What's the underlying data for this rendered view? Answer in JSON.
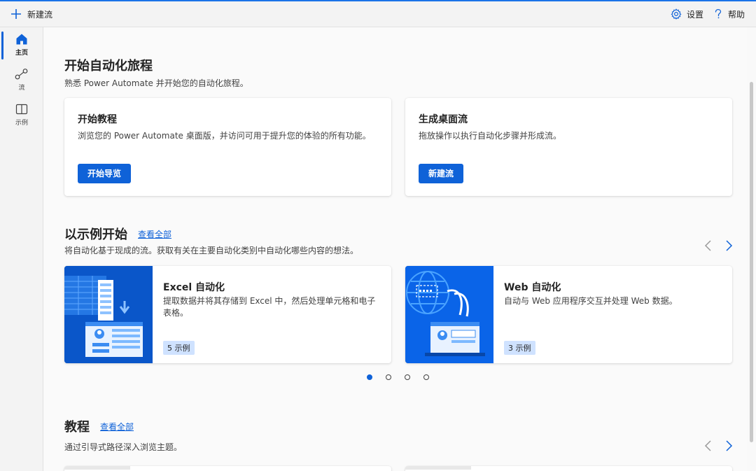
{
  "topbar": {
    "new_flow_label": "新建流",
    "settings_label": "设置",
    "help_label": "帮助"
  },
  "sidebar": {
    "items": [
      {
        "label": "主页",
        "icon": "home-icon",
        "active": true
      },
      {
        "label": "流",
        "icon": "flow-icon",
        "active": false
      },
      {
        "label": "示例",
        "icon": "examples-icon",
        "active": false
      }
    ]
  },
  "hero": {
    "title": "开始自动化旅程",
    "subtitle": "熟悉 Power Automate 并开始您的自动化旅程。",
    "cards": [
      {
        "title": "开始教程",
        "description": "浏览您的 Power Automate 桌面版，并访问可用于提升您的体验的所有功能。",
        "button": "开始导览"
      },
      {
        "title": "生成桌面流",
        "description": "拖放操作以执行自动化步骤并形成流。",
        "button": "新建流"
      }
    ]
  },
  "examples": {
    "title": "以示例开始",
    "see_all": "查看全部",
    "subtitle": "将自动化基于现成的流。获取有关在主要自动化类别中自动化哪些内容的想法。",
    "cards": [
      {
        "title": "Excel 自动化",
        "description": "提取数据并将其存储到 Excel 中，然后处理单元格和电子表格。",
        "badge": "5 示例"
      },
      {
        "title": "Web 自动化",
        "description": "自动与 Web 应用程序交互并处理 Web 数据。",
        "badge": "3 示例"
      }
    ],
    "pager": {
      "count": 4,
      "active_index": 0
    }
  },
  "tutorials": {
    "title": "教程",
    "see_all": "查看全部",
    "subtitle": "通过引导式路径深入浏览主题。"
  },
  "colors": {
    "accent": "#0f62d8",
    "sidebar_bg": "#f3f3f3",
    "content_bg": "#fafafa",
    "illustration_bg": "#0a56c9"
  }
}
